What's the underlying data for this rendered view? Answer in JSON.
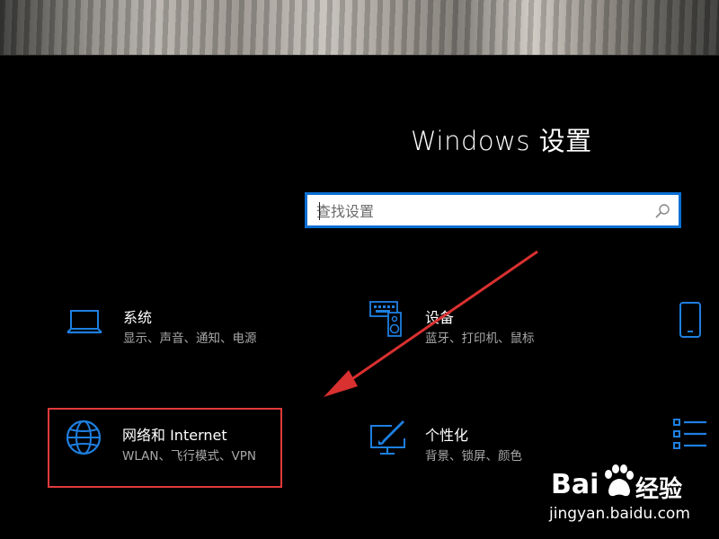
{
  "window": {
    "title": "Windows 设置"
  },
  "search": {
    "placeholder": "查找设置"
  },
  "categories": [
    {
      "label": "系统",
      "description": "显示、声音、通知、电源",
      "icon": "laptop-icon"
    },
    {
      "label": "设备",
      "description": "蓝牙、打印机、鼠标",
      "icon": "keyboard-speaker-icon"
    },
    {
      "label": "",
      "description": "",
      "icon": "phone-icon"
    },
    {
      "label": "网络和 Internet",
      "description": "WLAN、飞行模式、VPN",
      "icon": "globe-icon"
    },
    {
      "label": "个性化",
      "description": "背景、锁屏、颜色",
      "icon": "paint-monitor-icon"
    },
    {
      "label": "",
      "description": "",
      "icon": "list-icon"
    }
  ],
  "colors": {
    "accent": "#0a6fd4",
    "icon_blue": "#1e7fe0",
    "highlight": "#e03a3a",
    "background": "#000000"
  },
  "watermark": {
    "brand": "Bai",
    "brand2": "经验",
    "url": "jingyan.baidu.com"
  }
}
